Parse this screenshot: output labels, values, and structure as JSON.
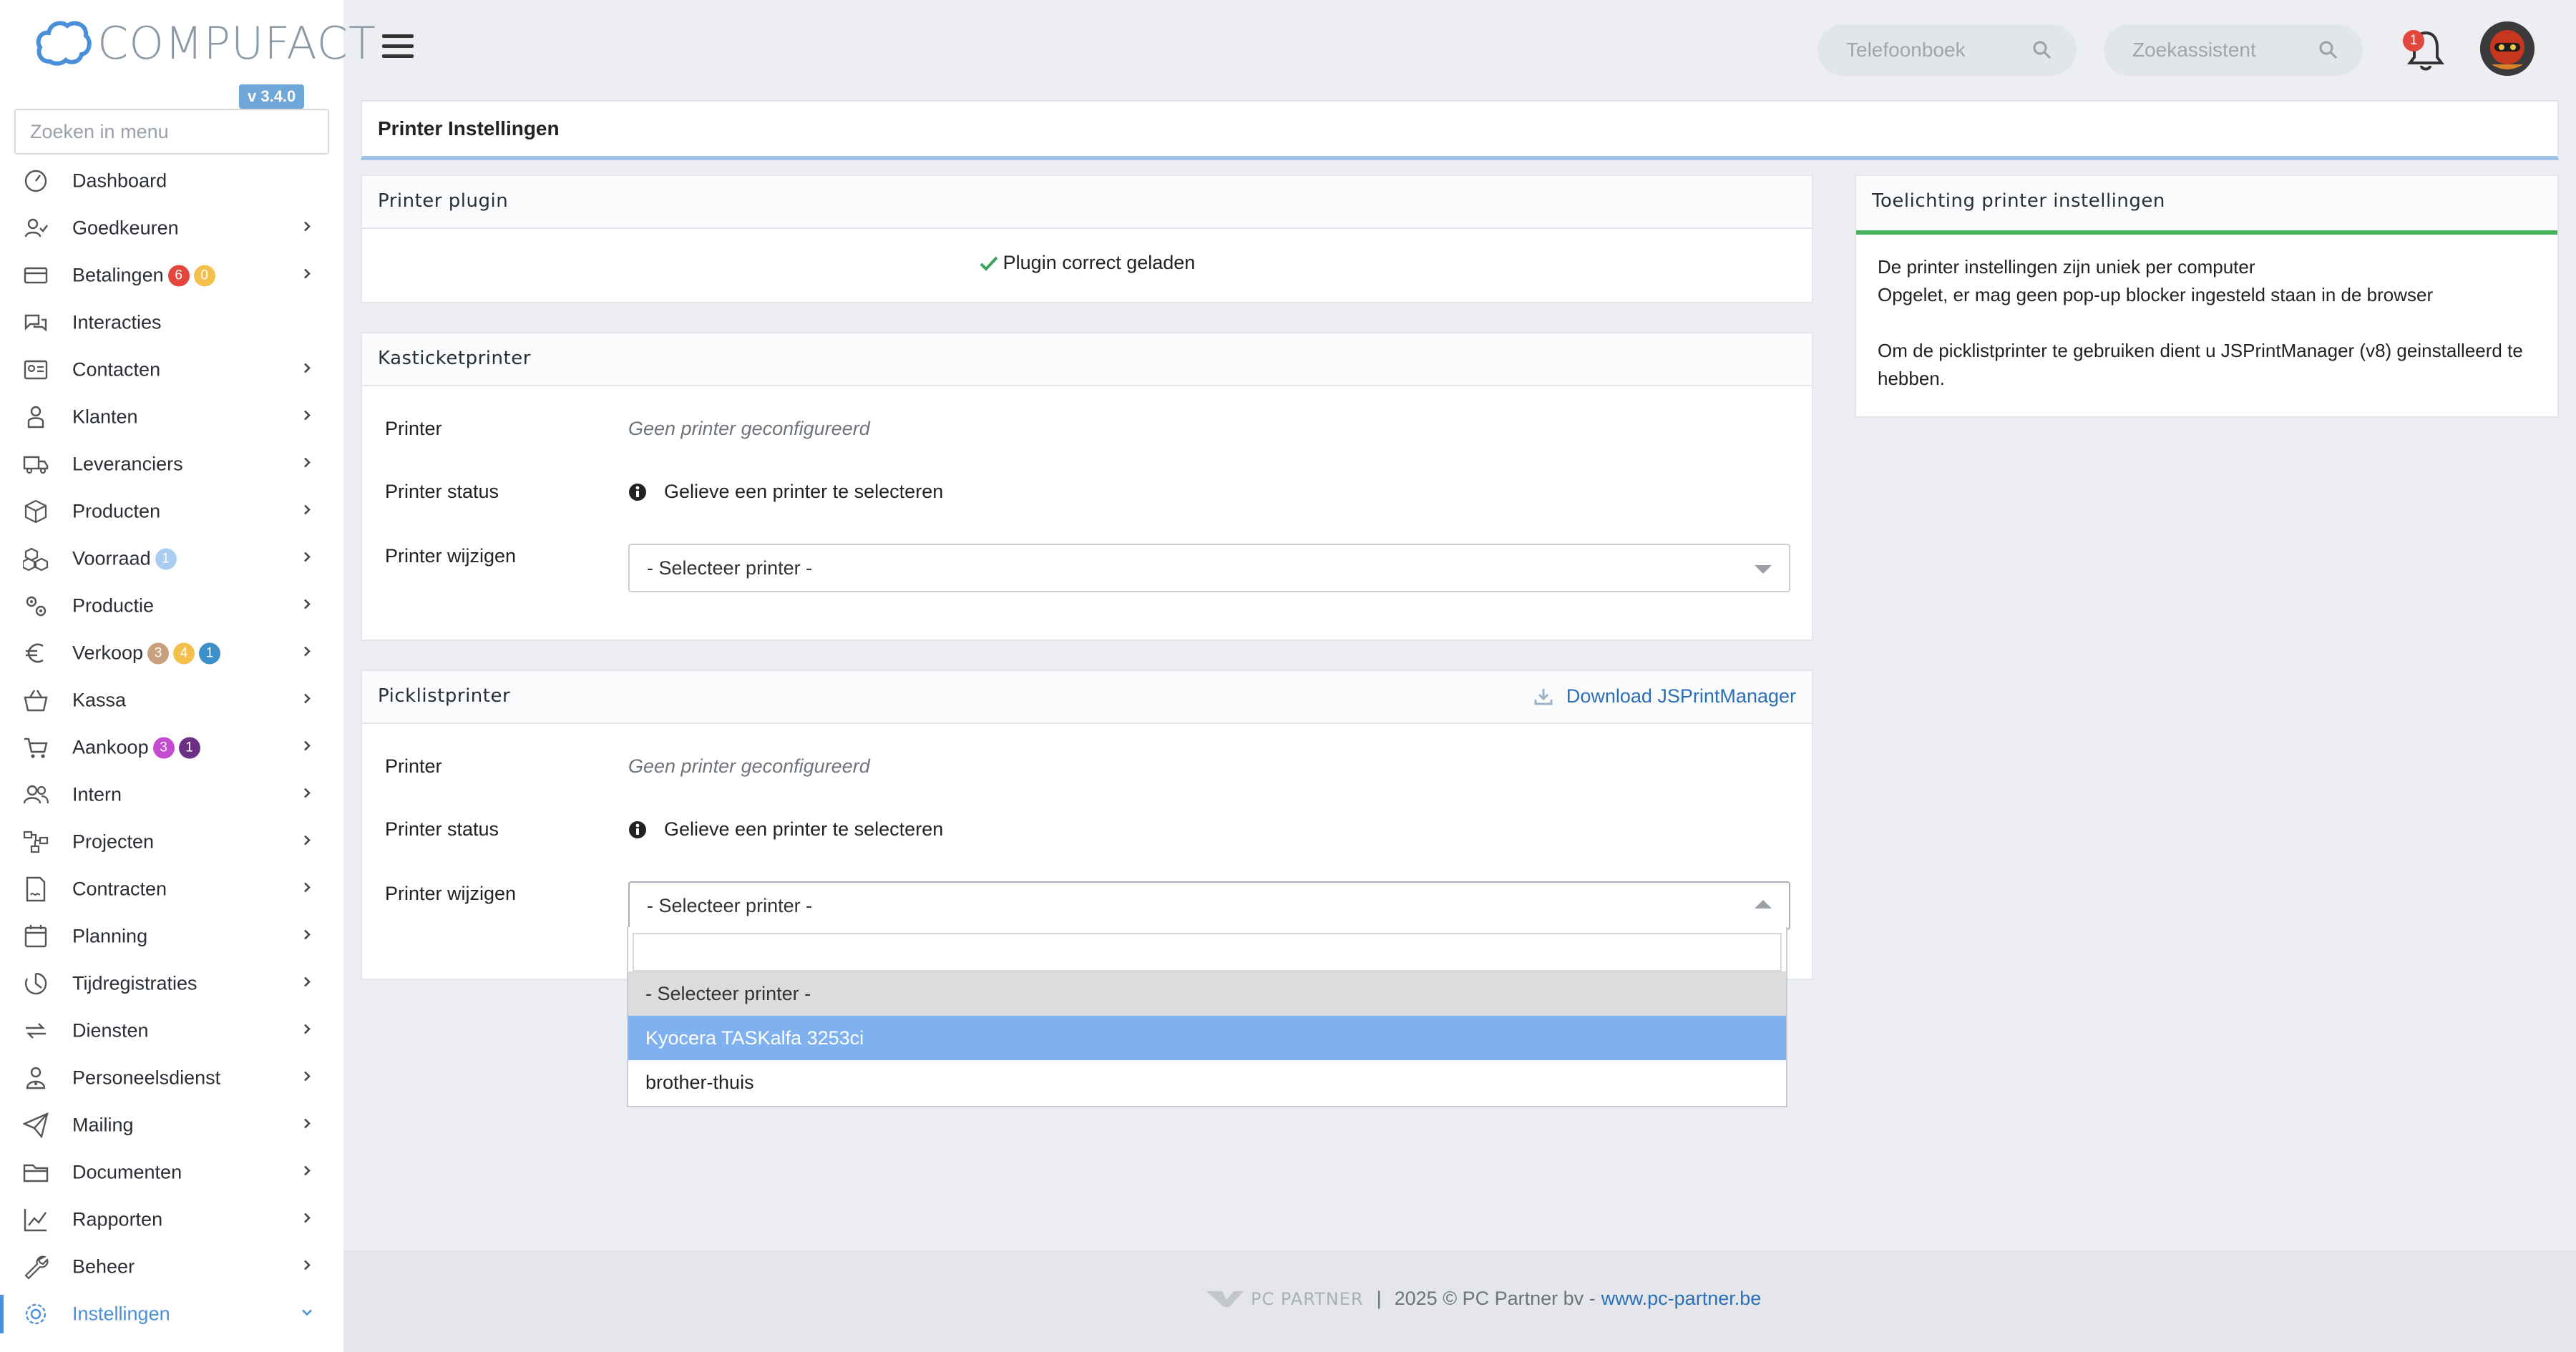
{
  "app": {
    "logo_text": "COMPUFACT",
    "version": "v 3.4.0",
    "menu_search_placeholder": "Zoeken in menu"
  },
  "sidebar": {
    "items": [
      {
        "label": "Dashboard",
        "icon": "dashboard-icon",
        "chevron": false,
        "badges": []
      },
      {
        "label": "Goedkeuren",
        "icon": "user-check-icon",
        "chevron": true,
        "badges": []
      },
      {
        "label": "Betalingen",
        "icon": "credit-card-icon",
        "chevron": true,
        "badges": [
          {
            "text": "6",
            "color": "#e2463c"
          },
          {
            "text": "0",
            "color": "#f3c14b"
          }
        ]
      },
      {
        "label": "Interacties",
        "icon": "chat-icon",
        "chevron": false,
        "badges": []
      },
      {
        "label": "Contacten",
        "icon": "contact-card-icon",
        "chevron": true,
        "badges": []
      },
      {
        "label": "Klanten",
        "icon": "customer-icon",
        "chevron": true,
        "badges": []
      },
      {
        "label": "Leveranciers",
        "icon": "truck-icon",
        "chevron": true,
        "badges": []
      },
      {
        "label": "Producten",
        "icon": "box-icon",
        "chevron": true,
        "badges": []
      },
      {
        "label": "Voorraad",
        "icon": "boxes-icon",
        "chevron": true,
        "badges": [
          {
            "text": "1",
            "color": "#a9cdf0"
          }
        ]
      },
      {
        "label": "Productie",
        "icon": "gears-icon",
        "chevron": true,
        "badges": []
      },
      {
        "label": "Verkoop",
        "icon": "euro-icon",
        "chevron": true,
        "badges": [
          {
            "text": "3",
            "color": "#c8a07e"
          },
          {
            "text": "4",
            "color": "#f3c14b"
          },
          {
            "text": "1",
            "color": "#3d8fc9"
          }
        ]
      },
      {
        "label": "Kassa",
        "icon": "basket-icon",
        "chevron": true,
        "badges": []
      },
      {
        "label": "Aankoop",
        "icon": "cart-icon",
        "chevron": true,
        "badges": [
          {
            "text": "3",
            "color": "#c44bd0"
          },
          {
            "text": "1",
            "color": "#6b2f84"
          }
        ]
      },
      {
        "label": "Intern",
        "icon": "users-icon",
        "chevron": true,
        "badges": []
      },
      {
        "label": "Projecten",
        "icon": "project-nodes-icon",
        "chevron": true,
        "badges": []
      },
      {
        "label": "Contracten",
        "icon": "contract-icon",
        "chevron": true,
        "badges": []
      },
      {
        "label": "Planning",
        "icon": "calendar-icon",
        "chevron": true,
        "badges": []
      },
      {
        "label": "Tijdregistraties",
        "icon": "timer-icon",
        "chevron": true,
        "badges": []
      },
      {
        "label": "Diensten",
        "icon": "repeat-icon",
        "chevron": true,
        "badges": []
      },
      {
        "label": "Personeelsdienst",
        "icon": "staff-icon",
        "chevron": true,
        "badges": []
      },
      {
        "label": "Mailing",
        "icon": "paper-plane-icon",
        "chevron": true,
        "badges": []
      },
      {
        "label": "Documenten",
        "icon": "folder-icon",
        "chevron": true,
        "badges": []
      },
      {
        "label": "Rapporten",
        "icon": "line-chart-icon",
        "chevron": true,
        "badges": []
      },
      {
        "label": "Beheer",
        "icon": "wrench-icon",
        "chevron": true,
        "badges": []
      },
      {
        "label": "Instellingen",
        "icon": "settings-gear-icon",
        "chevron": true,
        "badges": [],
        "active": true
      }
    ]
  },
  "topbar": {
    "phonebook_placeholder": "Telefoonboek",
    "assistant_placeholder": "Zoekassistent",
    "notifications_count": "1"
  },
  "page": {
    "title": "Printer Instellingen"
  },
  "plugin_card": {
    "title": "Printer plugin",
    "status": "Plugin correct geladen",
    "status_color": "#3aa35b"
  },
  "receipt_card": {
    "title": "Kasticketprinter",
    "printer_label": "Printer",
    "printer_value": "Geen printer geconfigureerd",
    "status_label": "Printer status",
    "status_value": "Gelieve een printer te selecteren",
    "change_label": "Printer wijzigen",
    "select_value": "- Selecteer printer -"
  },
  "picklist_card": {
    "title": "Picklistprinter",
    "download_label": "Download JSPrintManager",
    "printer_label": "Printer",
    "printer_value": "Geen printer geconfigureerd",
    "status_label": "Printer status",
    "status_value": "Gelieve een printer te selecteren",
    "change_label": "Printer wijzigen",
    "select_value": "- Selecteer printer -",
    "options": [
      "- Selecteer printer -",
      "Kyocera TASKalfa 3253ci",
      "brother-thuis"
    ],
    "highlighted_option": "Kyocera TASKalfa 3253ci"
  },
  "info_card": {
    "title": "Toelichting printer instellingen",
    "line1": "De printer instellingen zijn uniek per computer",
    "line2": "Opgelet, er mag geen pop-up blocker ingesteld staan in de browser",
    "line3": "Om de picklistprinter te gebruiken dient u JSPrintManager (v8) geinstalleerd te hebben."
  },
  "footer": {
    "brand": "PC PARTNER",
    "separator": "|",
    "copyright": "2025 © PC Partner bv -",
    "link": "www.pc-partner.be"
  },
  "colors": {
    "accent": "#4a90d9",
    "highlight": "#7fb0f0",
    "info_border": "#48b35f"
  }
}
